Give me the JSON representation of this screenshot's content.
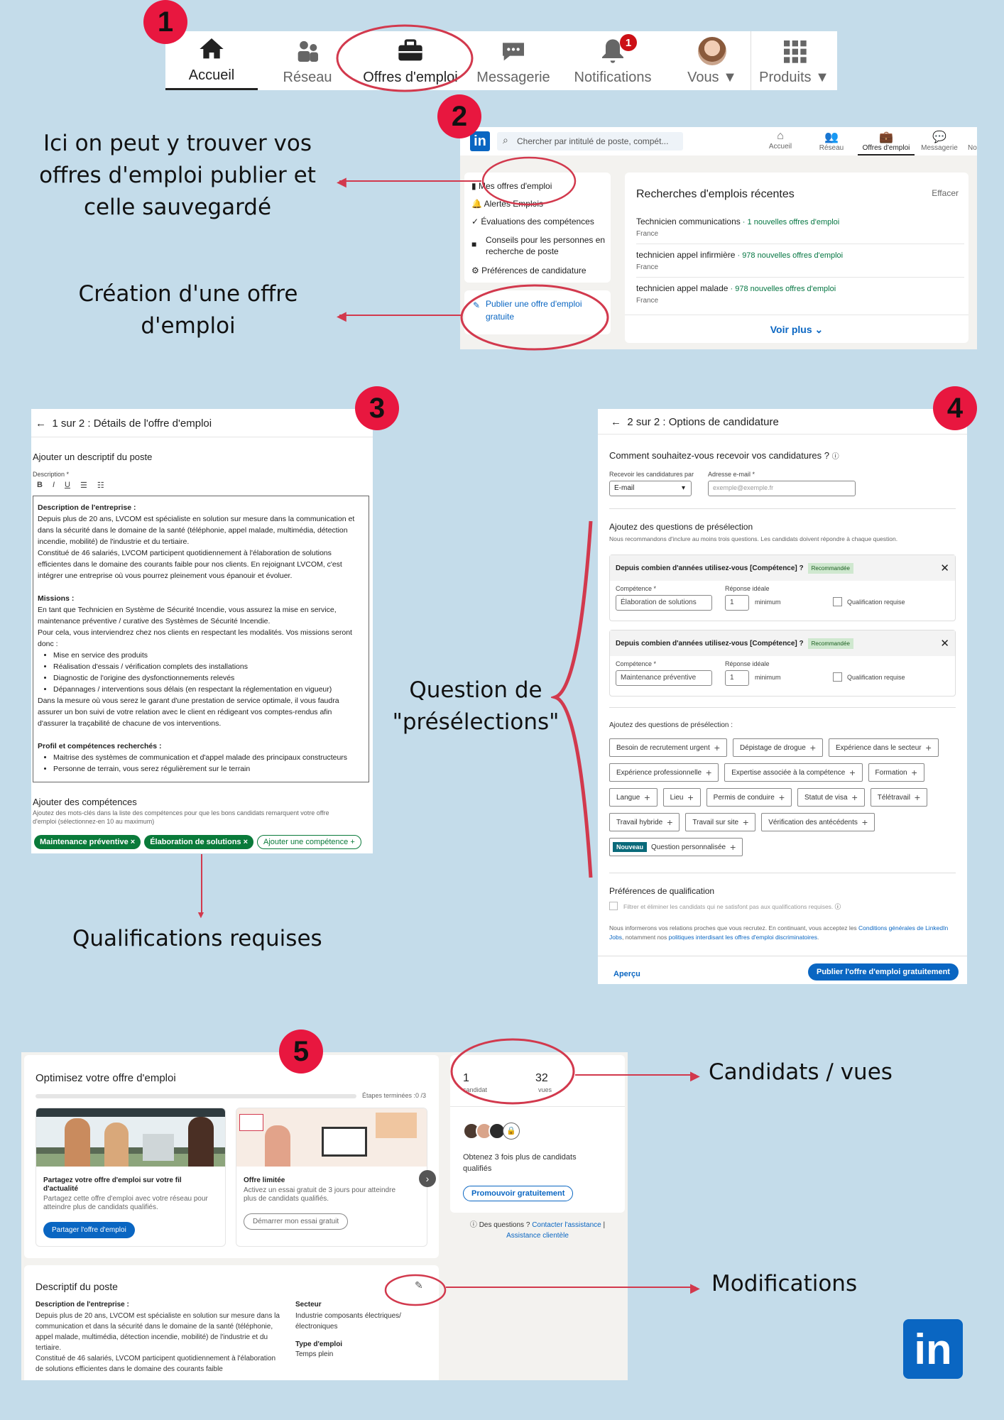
{
  "badges": [
    "1",
    "2",
    "3",
    "4",
    "5"
  ],
  "nav1": {
    "items": [
      {
        "label": "Accueil",
        "icon": "home-icon"
      },
      {
        "label": "Réseau",
        "icon": "network-icon"
      },
      {
        "label": "Offres d'emploi",
        "icon": "briefcase-icon"
      },
      {
        "label": "Messagerie",
        "icon": "messaging-icon"
      },
      {
        "label": "Notifications",
        "icon": "bell-icon",
        "count": "1"
      },
      {
        "label": "Vous",
        "icon": "avatar"
      },
      {
        "label": "Produits",
        "icon": "grid-icon"
      }
    ]
  },
  "captions": {
    "mine": "Ici on peut y trouver vos offres d'emploi publier et celle sauvegardé",
    "create": "Création d'une offre d'emploi",
    "quals": "Qualifications requises",
    "presel": "Question de \"présélections\"",
    "cands": "Candidats / vues",
    "mods": "Modifications"
  },
  "s2": {
    "logo": "in",
    "search_placeholder": "Chercher par intitulé de poste, compét...",
    "nav": [
      "Accueil",
      "Réseau",
      "Offres d'emploi",
      "Messagerie",
      "No"
    ],
    "menu": [
      "Mes offres d'emploi",
      "Alertes Emplois",
      "Évaluations des compétences",
      "Conseils pour les personnes en recherche de poste",
      "Préférences de candidature"
    ],
    "publish": "Publier une offre d'emploi gratuite",
    "recent_title": "Recherches d'emplois récentes",
    "clear": "Effacer",
    "searches": [
      {
        "title": "Technicien communications",
        "count": "1 nouvelles offres d'emploi",
        "loc": "France"
      },
      {
        "title": "technicien appel infirmière",
        "count": "978 nouvelles offres d'emploi",
        "loc": "France"
      },
      {
        "title": "technicien appel malade",
        "count": "978 nouvelles offres d'emploi",
        "loc": "France"
      }
    ],
    "more": "Voir plus"
  },
  "s3": {
    "title": "1 sur 2 : Détails de l'offre d'emploi",
    "section": "Ajouter un descriptif du poste",
    "desc_label": "Description *",
    "toolbar": [
      "B",
      "I",
      "U",
      "☰",
      "☷"
    ],
    "h_company": "Description de l'entreprise :",
    "p_company": "Depuis plus de 20 ans, LVCOM est spécialiste en solution sur mesure dans la communication et dans la sécurité dans le domaine de la santé (téléphonie, appel malade, multimédia, détection incendie, mobilité) de l'industrie et du tertiaire.",
    "p_company2": "Constitué de 46 salariés, LVCOM participent quotidiennement à l'élaboration de solutions efficientes dans le domaine des courants faible pour nos clients. En rejoignant LVCOM, c'est intégrer une entreprise où vous pourrez pleinement vous épanouir et évoluer.",
    "h_missions": "Missions :",
    "p_missions": "En tant que Technicien en Système de Sécurité Incendie, vous assurez la mise en service, maintenance préventive / curative des Systèmes de Sécurité Incendie.",
    "p_missions2": "Pour cela, vous interviendrez chez nos clients en respectant les modalités. Vos missions seront donc :",
    "missions": [
      "Mise en service des produits",
      "Réalisation d'essais / vérification complets des installations",
      "Diagnostic de l'origine des dysfonctionnements relevés",
      "Dépannages / interventions sous délais (en respectant la réglementation en vigueur)"
    ],
    "p_after": "Dans la mesure où vous serez le garant d'une prestation de service optimale, il vous faudra assurer un bon suivi de votre relation avec le client en rédigeant vos comptes-rendus afin d'assurer la traçabilité de chacune de vos interventions.",
    "h_profile": "Profil et compétences recherchés :",
    "profile": [
      "Maitrise des systèmes de communication et d'appel malade des principaux constructeurs",
      "Personne de terrain, vous serez régulièrement sur le terrain"
    ],
    "skills_title": "Ajouter des compétences",
    "skills_hint": "Ajoutez des mots-clés dans la liste des compétences pour que les bons candidats remarquent votre offre d'emploi (sélectionnez-en 10 au maximum)",
    "skills": [
      "Maintenance préventive ×",
      "Élaboration de solutions ×"
    ],
    "add_skill": "Ajouter une compétence +"
  },
  "s4": {
    "title": "2 sur 2 : Options de candidature",
    "how": "Comment souhaitez-vous recevoir vos candidatures ?",
    "recv_label": "Recevoir les candidatures par",
    "recv_value": "E-mail",
    "email_label": "Adresse e-mail *",
    "email_placeholder": "exemple@exemple.fr",
    "q_title": "Ajoutez des questions de présélection",
    "q_hint": "Nous recommandons d'inclure au moins trois questions. Les candidats doivent répondre à chaque question.",
    "q_head": "Depuis combien d'années utilisez-vous [Compétence] ?",
    "rec": "Recommandée",
    "comp_label": "Compétence *",
    "ideal_label": "Réponse idéale",
    "min": "minimum",
    "req": "Qualification requise",
    "q1_value": "Élaboration de solutions",
    "q2_value": "Maintenance préventive",
    "ideal_value": "1",
    "add_title": "Ajoutez des questions de présélection :",
    "chips": [
      "Besoin de recrutement urgent",
      "Dépistage de drogue",
      "Expérience dans le secteur",
      "Expérience professionnelle",
      "Expertise associée à la compétence",
      "Formation",
      "Langue",
      "Lieu",
      "Permis de conduire",
      "Statut de visa",
      "Télétravail",
      "Travail hybride",
      "Travail sur site",
      "Vérification des antécédents"
    ],
    "new": "Nouveau",
    "custom": "Question personnalisée",
    "pref_title": "Préférences de qualification",
    "pref_check": "Filtrer et éliminer les candidats qui ne satisfont pas aux qualifications requises.",
    "legal1": "Nous informerons vos relations proches que vous recrutez. En continuant, vous acceptez les ",
    "legal_link1": "Conditions générales de LinkedIn Jobs",
    "legal2": ", notamment nos ",
    "legal_link2": "politiques interdisant les offres d'emploi discriminatoires",
    "preview": "Aperçu",
    "publish": "Publier l'offre d'emploi gratuitement"
  },
  "s5": {
    "optimize": "Optimisez votre offre d'emploi",
    "steps": "Étapes terminées :0 /3",
    "card1_title": "Partagez votre offre d'emploi sur votre fil d'actualité",
    "card1_text": "Partagez cette offre d'emploi avec votre réseau pour atteindre plus de candidats qualifiés.",
    "card1_btn": "Partager l'offre d'emploi",
    "card2_title": "Offre limitée",
    "card2_text": "Activez un essai gratuit de 3 jours pour atteindre plus de candidats qualifiés.",
    "card2_btn": "Démarrer mon essai gratuit",
    "cand_num": "1",
    "cand_lbl": "candidat",
    "views_num": "32",
    "views_lbl": "vues",
    "promo_text": "Obtenez 3 fois plus de candidats qualifiés",
    "promo_btn": "Promouvoir gratuitement",
    "help_q": "Des questions ?",
    "help_link1": "Contacter l'assistance",
    "help_link2": "Assistance clientèle",
    "desc_title": "Descriptif du poste",
    "desc_h": "Description de l'entreprise :",
    "desc_p": "Depuis plus de 20 ans, LVCOM est spécialiste en solution sur mesure dans la communication et dans la sécurité dans le domaine de la santé (téléphonie, appel malade, multimédia, détection incendie, mobilité) de l'industrie et du tertiaire.",
    "desc_p2": "Constitué de 46 salariés, LVCOM participent quotidiennement à l'élaboration de solutions efficientes dans le domaine des courants faible",
    "sector_lbl": "Secteur",
    "sector_val": "Industrie composants électriques/ électroniques",
    "type_lbl": "Type d'emploi",
    "type_val": "Temps plein"
  },
  "footer_logo": "in",
  "colors": {
    "accent": "#e8173f",
    "linkedin": "#0a66c2",
    "green": "#0a7a3a",
    "bg": "#c4dcea"
  }
}
